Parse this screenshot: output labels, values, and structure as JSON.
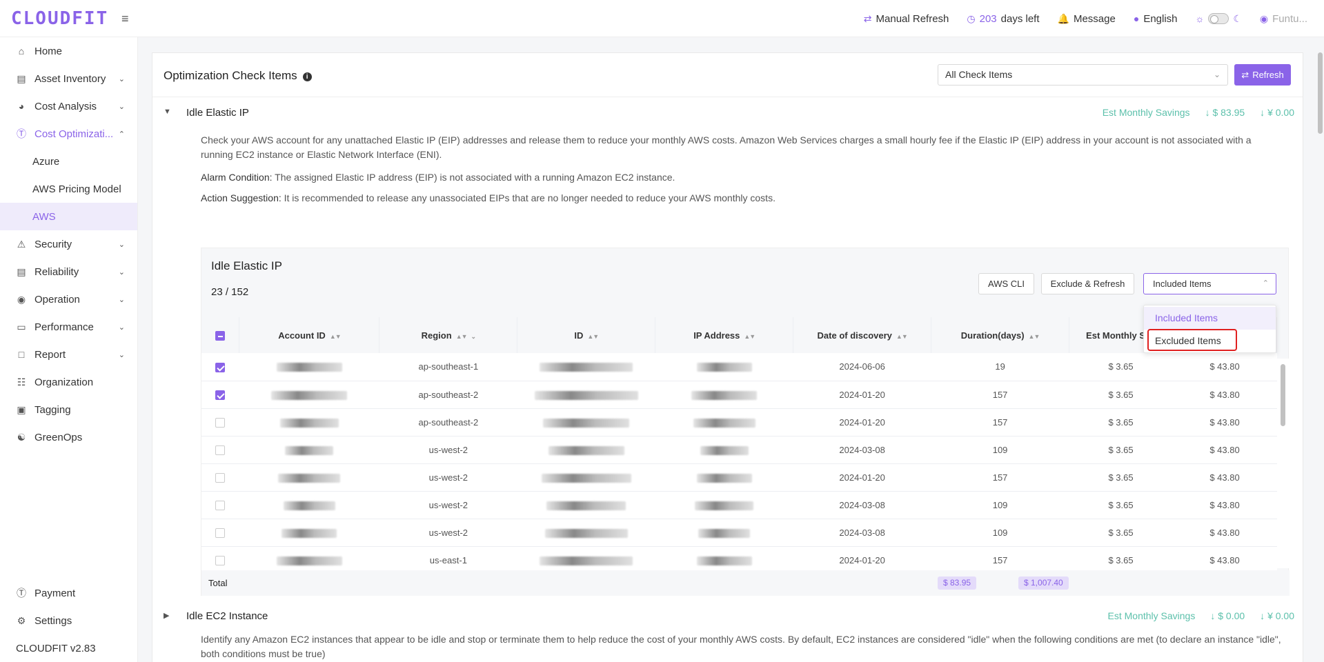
{
  "brand": {
    "logo": "CLOUDFIT",
    "version": "CLOUDFIT v2.83"
  },
  "topbar": {
    "manual_refresh": "Manual Refresh",
    "days_num": "203",
    "days_text": "days left",
    "message": "Message",
    "language": "English",
    "user": "Funtu..."
  },
  "sidebar": {
    "items": [
      {
        "label": "Home",
        "icon": "home-icon"
      },
      {
        "label": "Asset Inventory",
        "icon": "list-icon"
      },
      {
        "label": "Cost Analysis",
        "icon": "gauge-icon"
      },
      {
        "label": "Cost Optimizati...",
        "icon": "dollar-circle-icon"
      },
      {
        "label": "Azure"
      },
      {
        "label": "AWS Pricing Model"
      },
      {
        "label": "AWS"
      },
      {
        "label": "Security",
        "icon": "alarm-icon"
      },
      {
        "label": "Reliability",
        "icon": "document-icon"
      },
      {
        "label": "Operation",
        "icon": "eye-icon"
      },
      {
        "label": "Performance",
        "icon": "monitor-icon"
      },
      {
        "label": "Report",
        "icon": "file-icon"
      },
      {
        "label": "Organization",
        "icon": "org-icon"
      },
      {
        "label": "Tagging",
        "icon": "tag-icon"
      },
      {
        "label": "GreenOps",
        "icon": "leaf-icon"
      }
    ],
    "bottom": [
      {
        "label": "Payment",
        "icon": "dollar-icon"
      },
      {
        "label": "Settings",
        "icon": "gear-icon"
      }
    ]
  },
  "page": {
    "title": "Optimization Check Items",
    "filter_value": "All Check Items",
    "refresh_label": "Refresh"
  },
  "section1": {
    "title": "Idle Elastic IP",
    "savings_label": "Est Monthly Savings",
    "savings_usd": "$ 83.95",
    "savings_cny": "¥ 0.00",
    "description": "Check your AWS account for any unattached Elastic IP (EIP) addresses and release them to reduce your monthly AWS costs. Amazon Web Services charges a small hourly fee if the Elastic IP (EIP) address in your account is not associated with a running EC2 instance or Elastic Network Interface (ENI).",
    "alarm_label": "Alarm Condition:",
    "alarm_text": "The assigned Elastic IP address (EIP) is not associated with a running Amazon EC2 instance.",
    "action_label": "Action Suggestion:",
    "action_text": "It is recommended to release any unassociated EIPs that are no longer needed to reduce your AWS monthly costs."
  },
  "table": {
    "title": "Idle Elastic IP",
    "count": "23 / 152",
    "aws_cli": "AWS CLI",
    "exclude_refresh": "Exclude & Refresh",
    "filter_value": "Included Items",
    "dropdown": [
      "Included Items",
      "Excluded Items"
    ],
    "columns": [
      "Account ID",
      "Region",
      "ID",
      "IP Address",
      "Date of discovery",
      "Duration(days)",
      "Est Monthly Sav",
      ""
    ],
    "rows": [
      {
        "checked": true,
        "region": "ap-southeast-1",
        "date": "2024-06-06",
        "days": "19",
        "usd": "$ 3.65",
        "cny": "$ 43.80"
      },
      {
        "checked": true,
        "region": "ap-southeast-2",
        "date": "2024-01-20",
        "days": "157",
        "usd": "$ 3.65",
        "cny": "$ 43.80"
      },
      {
        "checked": false,
        "region": "ap-southeast-2",
        "date": "2024-01-20",
        "days": "157",
        "usd": "$ 3.65",
        "cny": "$ 43.80"
      },
      {
        "checked": false,
        "region": "us-west-2",
        "date": "2024-03-08",
        "days": "109",
        "usd": "$ 3.65",
        "cny": "$ 43.80"
      },
      {
        "checked": false,
        "region": "us-west-2",
        "date": "2024-01-20",
        "days": "157",
        "usd": "$ 3.65",
        "cny": "$ 43.80"
      },
      {
        "checked": false,
        "region": "us-west-2",
        "date": "2024-03-08",
        "days": "109",
        "usd": "$ 3.65",
        "cny": "$ 43.80"
      },
      {
        "checked": false,
        "region": "us-west-2",
        "date": "2024-03-08",
        "days": "109",
        "usd": "$ 3.65",
        "cny": "$ 43.80"
      },
      {
        "checked": false,
        "region": "us-east-1",
        "date": "2024-01-20",
        "days": "157",
        "usd": "$ 3.65",
        "cny": "$ 43.80"
      }
    ],
    "total_label": "Total",
    "total_usd": "$ 83.95",
    "total_cny": "$ 1,007.40"
  },
  "section2": {
    "title": "Idle EC2 Instance",
    "savings_label": "Est Monthly Savings",
    "savings_usd": "$ 0.00",
    "savings_cny": "¥ 0.00",
    "description": "Identify any Amazon EC2 instances that appear to be idle and stop or terminate them to help reduce the cost of your monthly AWS costs. By default, EC2 instances are considered \"idle\" when the following conditions are met (to declare an instance \"idle\", both conditions must be true)"
  },
  "colors": {
    "accent": "#8a63e8",
    "savings": "#5cc0ab",
    "highlight_box": "#e02020"
  }
}
